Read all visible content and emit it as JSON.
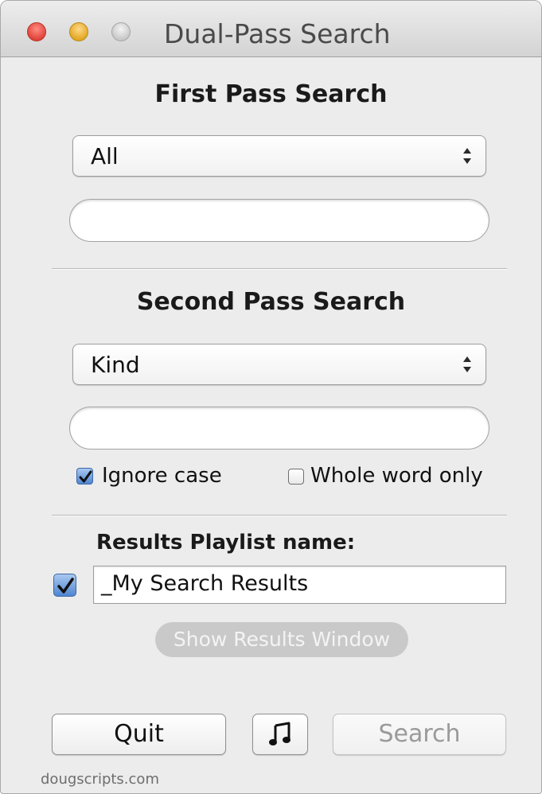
{
  "window": {
    "title": "Dual-Pass Search"
  },
  "first_pass": {
    "heading": "First Pass Search",
    "field_popup": {
      "selected": "All"
    },
    "search_value": ""
  },
  "second_pass": {
    "heading": "Second Pass Search",
    "field_popup": {
      "selected": "Kind"
    },
    "search_value": "",
    "ignore_case": {
      "label": "Ignore case",
      "checked": true
    },
    "whole_word": {
      "label": "Whole word only",
      "checked": false
    }
  },
  "results": {
    "label": "Results Playlist name:",
    "enabled": true,
    "playlist_name": "_My Search Results",
    "show_window_label": "Show Results Window"
  },
  "buttons": {
    "quit_label": "Quit",
    "itunes_icon": "music-note-icon",
    "search_label": "Search"
  },
  "footer": {
    "text": "dougscripts.com"
  },
  "colors": {
    "window_bg": "#ececec",
    "checkbox_checked": "#4f86d0",
    "close": "#e0443a",
    "minimize": "#e3a823"
  }
}
